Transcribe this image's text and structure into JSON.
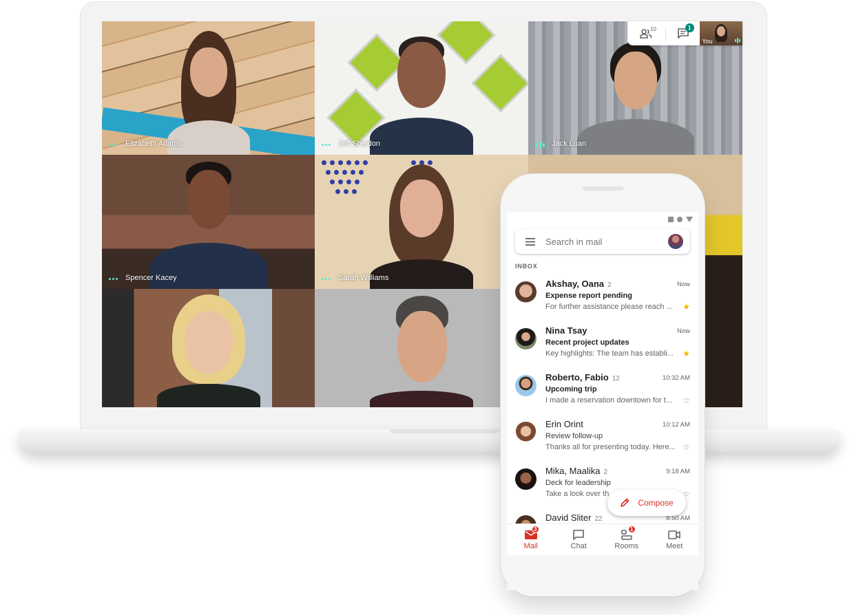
{
  "meet": {
    "participants": [
      {
        "name": "Elizabeth Adams",
        "audio": "idle"
      },
      {
        "name": "Jeff Sheldon",
        "audio": "idle"
      },
      {
        "name": "Jack Luan",
        "audio": "speaking"
      },
      {
        "name": "Spencer Kacey",
        "audio": "idle"
      },
      {
        "name": "Sarah Williams",
        "audio": "idle"
      },
      {
        "name": "",
        "audio": ""
      },
      {
        "name": "",
        "audio": ""
      },
      {
        "name": "",
        "audio": ""
      },
      {
        "name": "",
        "audio": ""
      }
    ],
    "callbar": {
      "people_icon": "people-icon",
      "people_count": "10",
      "chat_icon": "chat-icon",
      "chat_badge": "1",
      "self_label": "You"
    },
    "accent": "#5ee7cf"
  },
  "gmail": {
    "status_icons": [
      "square-icon",
      "circle-icon",
      "triangle-icon"
    ],
    "search": {
      "placeholder": "Search in mail",
      "menu_icon": "hamburger-icon"
    },
    "section_label": "INBOX",
    "emails": [
      {
        "sender": "Akshay, Oana",
        "count": "2",
        "time": "Now",
        "subject": "Expense report pending",
        "snippet": "For further assistance please reach ...",
        "unread": true,
        "starred": true
      },
      {
        "sender": "Nina Tsay",
        "count": "",
        "time": "Now",
        "subject": "Recent project updates",
        "snippet": "Key highlights:  The team has establi...",
        "unread": true,
        "starred": true
      },
      {
        "sender": "Roberto, Fabio",
        "count": "12",
        "time": "10:32 AM",
        "subject": "Upcoming trip",
        "snippet": "I made a reservation downtown for t...",
        "unread": true,
        "starred": false
      },
      {
        "sender": "Erin Orint",
        "count": "",
        "time": "10:12 AM",
        "subject": "Review follow-up",
        "snippet": "Thanks all for presenting today. Here...",
        "unread": false,
        "starred": false
      },
      {
        "sender": "Mika, Maalika",
        "count": "2",
        "time": "9:18 AM",
        "subject": "Deck for leadership",
        "snippet": "Take a look over th",
        "unread": false,
        "starred": false
      },
      {
        "sender": "David Sliter",
        "count": "22",
        "time": "8:50 AM",
        "subject": "",
        "snippet": "",
        "unread": false,
        "starred": false
      }
    ],
    "compose_label": "Compose",
    "nav": [
      {
        "label": "Mail",
        "icon": "mail-icon",
        "badge": "3",
        "active": true
      },
      {
        "label": "Chat",
        "icon": "chat-icon",
        "badge": "",
        "active": false
      },
      {
        "label": "Rooms",
        "icon": "rooms-icon",
        "badge": "1",
        "active": false
      },
      {
        "label": "Meet",
        "icon": "video-icon",
        "badge": "",
        "active": false
      }
    ],
    "colors": {
      "brand_red": "#d93025",
      "star": "#f4b400"
    }
  }
}
